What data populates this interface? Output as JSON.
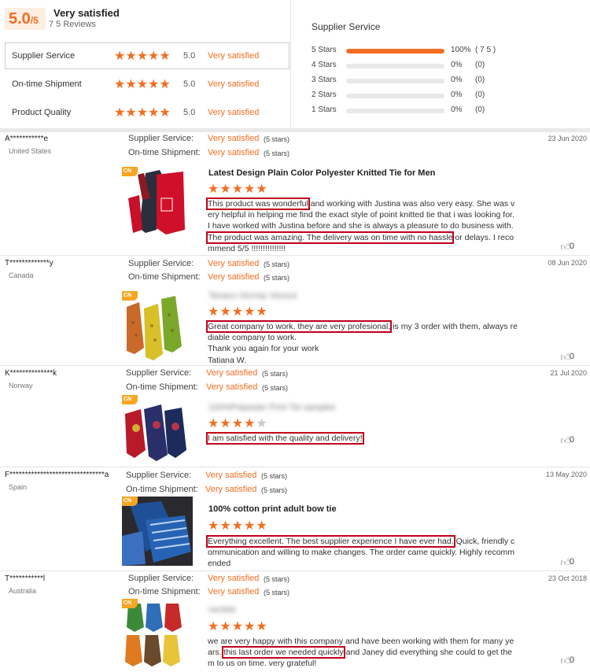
{
  "summary": {
    "score": "5.0",
    "score_denominator": "/5",
    "overall_label": "Very satisfied",
    "reviews_count": "7 5 Reviews",
    "categories": [
      {
        "name": "Supplier Service",
        "stars": "★★★★★",
        "score": "5.0",
        "label": "Very satisfied"
      },
      {
        "name": "On-time Shipment",
        "stars": "★★★★★",
        "score": "5.0",
        "label": "Very satisfied"
      },
      {
        "name": "Product Quality",
        "stars": "★★★★★",
        "score": "5.0",
        "label": "Very satisfied"
      }
    ],
    "supplier_service_title": "Supplier Service",
    "distribution": [
      {
        "label": "5 Stars",
        "percent": 100,
        "percent_text": "100%",
        "count": "( 7 5 )"
      },
      {
        "label": "4 Stars",
        "percent": 0,
        "percent_text": "0%",
        "count": "(0)"
      },
      {
        "label": "3 Stars",
        "percent": 0,
        "percent_text": "0%",
        "count": "(0)"
      },
      {
        "label": "2 Stars",
        "percent": 0,
        "percent_text": "0%",
        "count": "(0)"
      },
      {
        "label": "1 Stars",
        "percent": 0,
        "percent_text": "0%",
        "count": "(0)"
      }
    ]
  },
  "meta_labels": {
    "supplier_service": "Supplier Service:",
    "ontime_shipment": "On-time Shipment:",
    "value": "Very satisfied",
    "stars": "(5 stars)"
  },
  "colors": {
    "accent": "#f26e22",
    "highlight_box": "#c0001a"
  },
  "cn_tag": "CN",
  "reviews": [
    {
      "reviewer": "A***********e",
      "country": "United States",
      "date": "23 Jun 2020",
      "product_title": "Latest Design Plain Color Polyester Knitted Tie for Men",
      "rating": 5,
      "stars": "★★★★★",
      "text_hl1": "This product was wonderful",
      "text_mid": " and working with Justina was also very easy. She was very helpful in helping me find the exact style of point knitted tie that i was looking for. I have worked with Justina before and she is always a pleasure to do business with.",
      "text_hl2": "The product was amazing. The delivery was on time with no hassle",
      "text_end": " or delays. I recommend 5/5 !!!!!!!!!!!!!!!",
      "likes": "0"
    },
    {
      "reviewer": "T*************y",
      "country": "Canada",
      "date": "08 Jun 2020",
      "product_title": "Tanaco Vicrnsy Vocsce",
      "rating": 5,
      "stars": "★★★★★",
      "text_hl1": "Great company to work, they are very profesional,",
      "text_mid": " is my 3 order with them, always rediable company to work.",
      "line2": "Thank you again for your work",
      "line3": "Tatiana W.",
      "likes": "0"
    },
    {
      "reviewer": "K**************k",
      "country": "Norway",
      "date": "21 Jul 2020",
      "product_title": "100%Polyester Print Tie samples",
      "rating": 4,
      "stars_on": "★★★★",
      "stars_off": "★",
      "text_hl1": "I am satisfied with the quality and delivery!",
      "likes": "0"
    },
    {
      "reviewer": "F*******************************a",
      "country": "Spain",
      "date": "13 May 2020",
      "product_title": "100% cotton print adult bow tie",
      "rating": 5,
      "stars": "★★★★★",
      "text_hl1": "Everything excellent. The best supplier experience I have ever had.",
      "text_mid": " Quick, friendly communication and willing to make changes. The order came quickly. Highly recommended",
      "likes": "0"
    },
    {
      "reviewer": "T***********l",
      "country": "Australia",
      "date": "23 Oct 2018",
      "product_title": "necktie",
      "rating": 5,
      "stars": "★★★★★",
      "text_pre": "we are very happy with this company and have been working with them for many years. ",
      "text_hl1": "this last order we needed quickly",
      "text_mid": " and Janey did everything she could to get them to us on time.  very grateful!",
      "likes": "0"
    }
  ]
}
